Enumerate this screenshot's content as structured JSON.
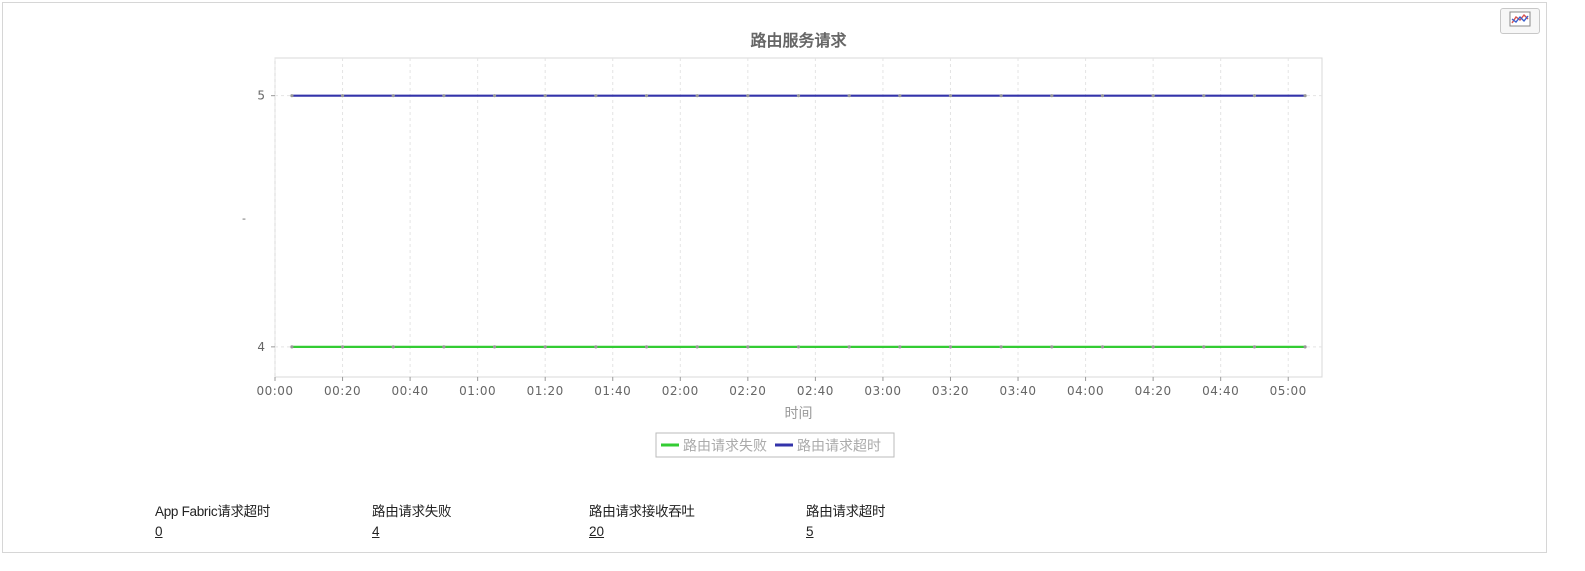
{
  "chart_data": {
    "type": "line",
    "title": "路由服务请求",
    "xlabel": "时间",
    "ylabel": "-",
    "x_tick_labels": [
      "00:00",
      "00:20",
      "00:40",
      "01:00",
      "01:20",
      "01:40",
      "02:00",
      "02:20",
      "02:40",
      "03:00",
      "03:20",
      "03:40",
      "04:00",
      "04:20",
      "04:40",
      "05:00"
    ],
    "x_range_minutes": [
      0,
      310
    ],
    "x_minutes": [
      5,
      20,
      35,
      50,
      65,
      80,
      95,
      110,
      125,
      140,
      155,
      170,
      185,
      200,
      215,
      230,
      245,
      260,
      275,
      290,
      305
    ],
    "ylim": [
      3.88,
      5.15
    ],
    "y_ticks": [
      4,
      5
    ],
    "grid": true,
    "legend_position": "bottom-center",
    "series": [
      {
        "name": "路由请求失败",
        "color": "#33cc33",
        "values": [
          4,
          4,
          4,
          4,
          4,
          4,
          4,
          4,
          4,
          4,
          4,
          4,
          4,
          4,
          4,
          4,
          4,
          4,
          4,
          4,
          4
        ]
      },
      {
        "name": "路由请求超时",
        "color": "#3333aa",
        "values": [
          5,
          5,
          5,
          5,
          5,
          5,
          5,
          5,
          5,
          5,
          5,
          5,
          5,
          5,
          5,
          5,
          5,
          5,
          5,
          5,
          5
        ]
      }
    ]
  },
  "metrics": [
    {
      "label": "App Fabric请求超时",
      "value": "0"
    },
    {
      "label": "路由请求失败",
      "value": "4"
    },
    {
      "label": "路由请求接收吞吐",
      "value": "20"
    },
    {
      "label": "路由请求超时",
      "value": "5"
    }
  ],
  "toolbar": {
    "chart_toggle_icon": "line-chart-icon"
  }
}
